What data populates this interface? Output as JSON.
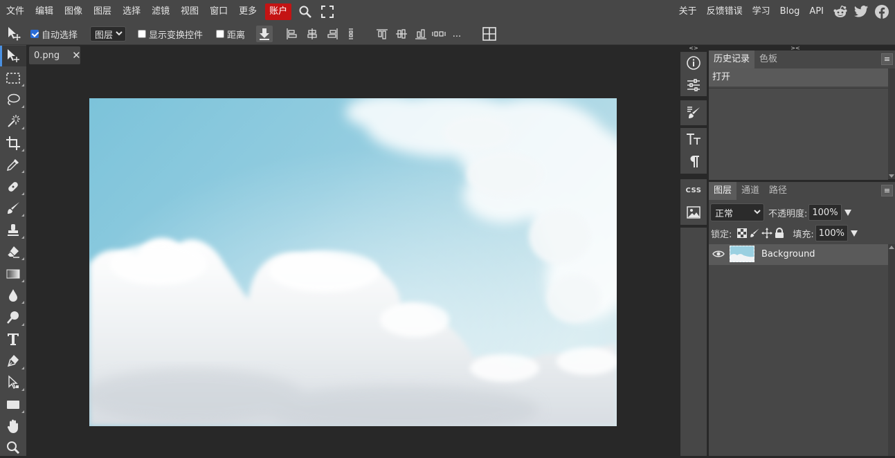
{
  "menubar": {
    "items": [
      "文件",
      "编辑",
      "图像",
      "图层",
      "选择",
      "滤镜",
      "视图",
      "窗口",
      "更多"
    ],
    "account": "账户",
    "right_items": [
      "关于",
      "反馈错误",
      "学习",
      "Blog",
      "API"
    ],
    "social": [
      "reddit-icon",
      "twitter-icon",
      "facebook-icon"
    ],
    "accent_color": "#c41414"
  },
  "options": {
    "auto_select_label": "自动选择",
    "auto_select_checked": true,
    "layer_select_value": "图层",
    "show_transform_label": "显示变换控件",
    "show_transform_checked": false,
    "distance_label": "距离",
    "distance_checked": false,
    "more": "..."
  },
  "document": {
    "tab_name": "0.png",
    "close_glyph": "✕"
  },
  "sidebar": {
    "collapse_left": "<>",
    "collapse_right": "><",
    "css_label": "CSS"
  },
  "history": {
    "tabs": [
      "历史记录",
      "色板"
    ],
    "items": [
      "打开"
    ]
  },
  "layers": {
    "tabs": [
      "图层",
      "通道",
      "路径"
    ],
    "blend_mode": "正常",
    "opacity_label": "不透明度:",
    "opacity_value": "100%",
    "lock_label": "锁定:",
    "fill_label": "填充:",
    "fill_value": "100%",
    "items": [
      {
        "name": "Background",
        "visible": true
      }
    ]
  }
}
